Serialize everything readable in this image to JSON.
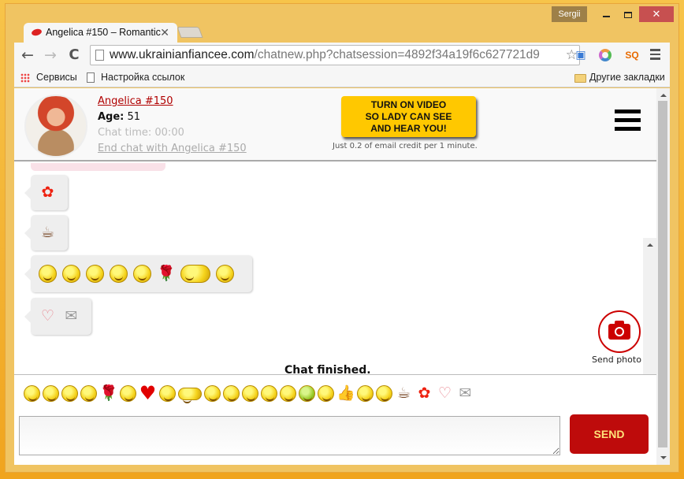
{
  "window": {
    "user": "Sergii",
    "minimize_icon": "minimize-icon",
    "maximize_icon": "maximize-icon",
    "close_label": "✕"
  },
  "browser": {
    "tab_title": "Angelica #150 – Romantic",
    "tab_close": "✕",
    "url_host": "www.ukrainianfiancee.com",
    "url_path": "/chatnew.php?chatsession=4892f34a19f6c627721d9",
    "back": "←",
    "forward": "→",
    "reload": "C",
    "star": "☆",
    "ext_sq": "SQ"
  },
  "bookmarks": {
    "apps": "Сервисы",
    "settings": "Настройка ссылок",
    "other": "Другие закладки"
  },
  "header": {
    "name": "Angelica #150",
    "age_label": "Age:",
    "age_value": "51",
    "chat_time": "Chat time: 00:00",
    "end_chat": "End chat with Angelica #150",
    "video_button": "TURN ON VIDEO\nSO LADY CAN SEE\nAND HEAR YOU!",
    "video_note": "Just 0.2 of email credit per 1 minute."
  },
  "messages": [
    {
      "items": [
        "flower"
      ]
    },
    {
      "items": [
        "coffee"
      ]
    },
    {
      "items": [
        "smile",
        "blush",
        "angel",
        "cool",
        "cry",
        "rose",
        "hug",
        "kiss"
      ]
    },
    {
      "items": [
        "hearts",
        "love-letter"
      ]
    }
  ],
  "send_photo_label": "Send photo",
  "chat_status": "Chat finished.",
  "emoji_bar": [
    "angel",
    "blush",
    "cool",
    "cry",
    "rose",
    "smile",
    "heart",
    "kiss-blow",
    "hug",
    "wink-kiss",
    "kiss",
    "laugh",
    "in-love",
    "sad",
    "sick",
    "surprised",
    "thumbs-up",
    "tongue",
    "wink",
    "coffee",
    "flower",
    "hearts",
    "love-letter"
  ],
  "input": {
    "value": "",
    "placeholder": ""
  },
  "send_button": "SEND",
  "glyphs": {
    "flower": "✿",
    "coffee": "☕",
    "rose": "🌹",
    "hearts": "♡",
    "love-letter": "✉",
    "heart": "♥",
    "thumbs-up": "👍"
  }
}
